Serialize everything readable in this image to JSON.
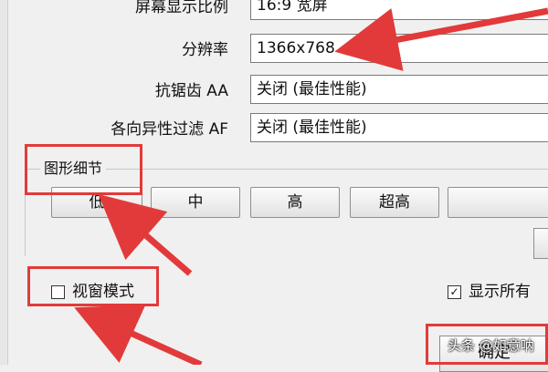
{
  "settings": [
    {
      "label": "屏幕显示比例",
      "value": "16:9 宽屏"
    },
    {
      "label": "分辨率",
      "value": "1366x768"
    },
    {
      "label": "抗锯齿 AA",
      "value": "关闭 (最佳性能)"
    },
    {
      "label": "各向异性过滤 AF",
      "value": "关闭 (最佳性能)"
    }
  ],
  "graphics_detail": {
    "title": "图形细节",
    "buttons": [
      "低",
      "中",
      "高",
      "超高"
    ]
  },
  "window_mode": {
    "label": "视窗模式",
    "checked": false
  },
  "show_all": {
    "label": "显示所有",
    "checked": true,
    "mark": "✓"
  },
  "ok_button": "确定",
  "watermark": "头条 @如意呐",
  "annotation_color": "#e23a3a"
}
